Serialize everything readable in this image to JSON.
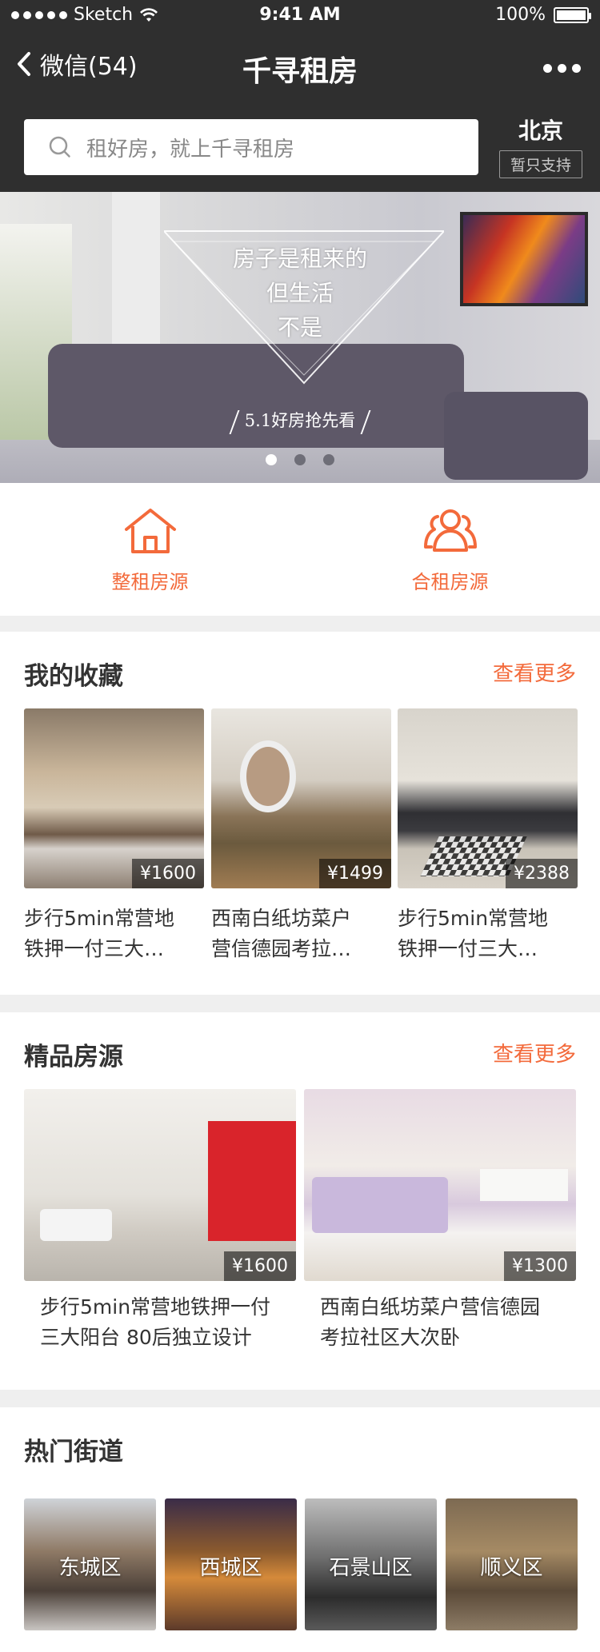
{
  "status": {
    "carrier": "Sketch",
    "time": "9:41 AM",
    "battery": "100%"
  },
  "nav": {
    "back_label": "微信(54)",
    "title": "千寻租房"
  },
  "search": {
    "placeholder": "租好房，就上千寻租房",
    "city": "北京",
    "city_badge": "暂只支持"
  },
  "banner": {
    "slogan": [
      "房子是租来的",
      "但生活",
      "不是"
    ],
    "subtitle": "5.1好房抢先看",
    "pages": 3,
    "active_page": 0
  },
  "entries": [
    {
      "label": "整租房源",
      "icon": "house-icon"
    },
    {
      "label": "合租房源",
      "icon": "people-icon"
    }
  ],
  "favorites": {
    "title": "我的收藏",
    "more": "查看更多",
    "items": [
      {
        "price": "¥1600",
        "line1": "步行5min常营地",
        "line2": "铁押一付三大…"
      },
      {
        "price": "¥1499",
        "line1": "西南白纸坊菜户",
        "line2": "营信德园考拉…"
      },
      {
        "price": "¥2388",
        "line1": "步行5min常营地",
        "line2": "铁押一付三大…"
      }
    ]
  },
  "premium": {
    "title": "精品房源",
    "more": "查看更多",
    "items": [
      {
        "price": "¥1600",
        "line1": "步行5min常营地铁押一付",
        "line2": "三大阳台 80后独立设计"
      },
      {
        "price": "¥1300",
        "line1": "西南白纸坊菜户营信德园",
        "line2": "考拉社区大次卧"
      }
    ]
  },
  "streets": {
    "title": "热门街道",
    "items": [
      {
        "label": "东城区"
      },
      {
        "label": "西城区"
      },
      {
        "label": "石景山区"
      },
      {
        "label": "顺义区"
      }
    ]
  },
  "colors": {
    "accent": "#f36a3b",
    "nav_bg": "#2f2f2f"
  }
}
